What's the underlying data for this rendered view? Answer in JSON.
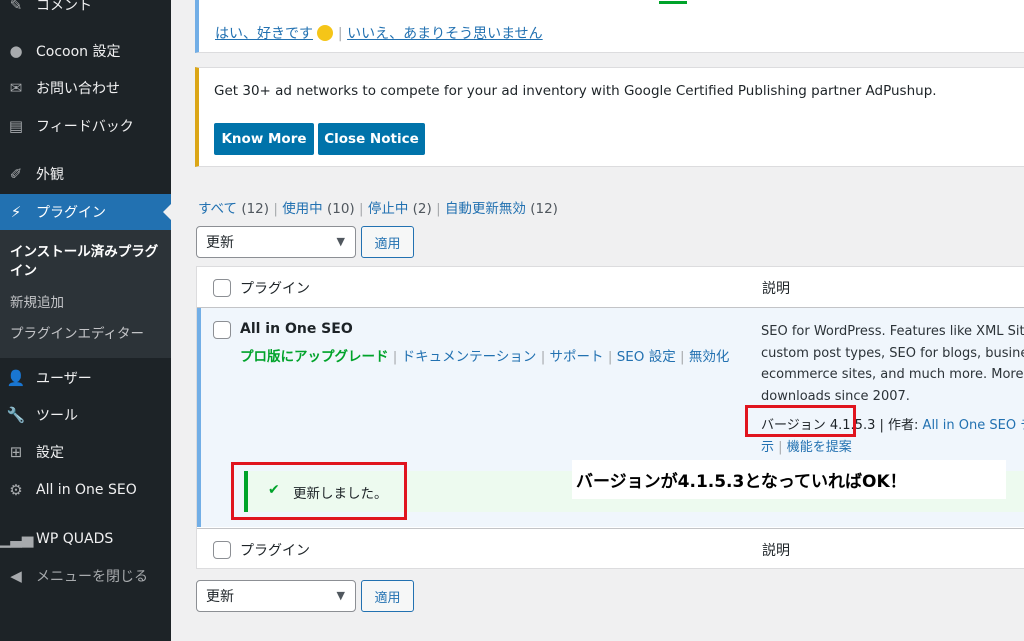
{
  "sidebar": {
    "comment_label": "コメント",
    "cocoon_label": "Cocoon 設定",
    "contact_label": "お問い合わせ",
    "feedback_label": "フィードバック",
    "appearance_label": "外観",
    "plugins_label": "プラグイン",
    "submenu": {
      "installed_label": "インストール済みプラグイン",
      "add_new_label": "新規追加",
      "editor_label": "プラグインエディター"
    },
    "users_label": "ユーザー",
    "tools_label": "ツール",
    "settings_label": "設定",
    "aioseo_label": "All in One SEO",
    "wpquads_label": "WP QUADS",
    "collapse_label": "メニューを閉じる"
  },
  "review_notice": {
    "yes_link": "はい、好きです",
    "separator": "|",
    "no_link": "いいえ、あまりそう思いません"
  },
  "ad_notice": {
    "text": "Get 30+ ad networks to compete for your ad inventory with Google Certified Publishing partner AdPushup.",
    "know_more_label": "Know More",
    "close_label": "Close Notice"
  },
  "filters": {
    "all_label": "すべて",
    "all_count": "(12)",
    "active_label": "使用中",
    "active_count": "(10)",
    "inactive_label": "停止中",
    "inactive_count": "(2)",
    "autoupdate_label": "自動更新無効",
    "autoupdate_count": "(12)"
  },
  "bulk": {
    "selected": "更新",
    "apply_label": "適用"
  },
  "table": {
    "col_plugin": "プラグイン",
    "col_description": "説明",
    "row": {
      "name": "All in One SEO",
      "actions": {
        "upgrade": "プロ版にアップグレード",
        "docs": "ドキュメンテーション",
        "support": "サポート",
        "seo_settings": "SEO 設定",
        "deactivate": "無効化"
      },
      "description_lines": [
        "SEO for WordPress. Features like XML Siten",
        "custom post types, SEO for blogs, business",
        "ecommerce sites, and much more. More th",
        "downloads since 2007."
      ],
      "version": "バージョン 4.1.5.3",
      "author_prefix": "| 作者:",
      "author_link": "All in One SEO チ",
      "view_details_partial": "示",
      "feature_request": "機能を提案",
      "update_notice": "更新しました。"
    }
  },
  "annotation": {
    "text": "バージョンが4.1.5.3となっていればOK！"
  },
  "colors": {
    "accent": "#2271b1",
    "sidebar_bg": "#1d2327",
    "success": "#00a32a",
    "annotation_red": "#e0141e"
  }
}
